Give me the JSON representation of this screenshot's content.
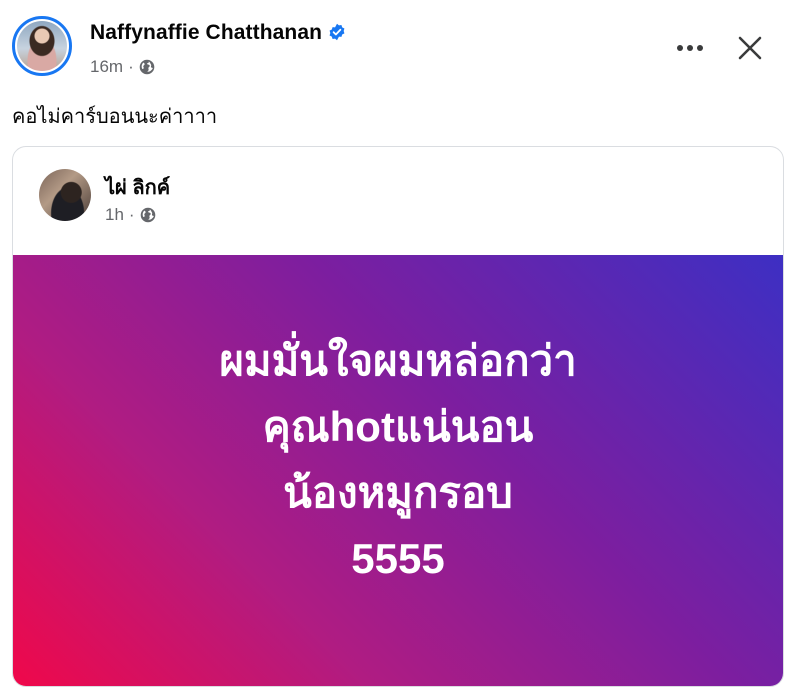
{
  "post": {
    "author": "Naffynaffie Chatthanan",
    "verified": true,
    "time": "16m",
    "separator": "·",
    "caption": "คอไม่คาร์บอนนะค่าาาา",
    "icons": {
      "more": "more-horizontal-icon",
      "close": "close-icon",
      "privacy": "globe-icon",
      "badge": "verified-badge-icon"
    }
  },
  "shared": {
    "author": "ไผ่ ลิกค์",
    "time": "1h",
    "separator": "·",
    "lines": [
      "ผมมั่นใจผมหล่อกว่า",
      "คุณhotแน่นอน",
      "น้องหมูกรอบ",
      "5555"
    ],
    "colors": {
      "gradient_start": "#f0084a",
      "gradient_end": "#3d2fc3"
    }
  },
  "colors": {
    "accent": "#1877f2",
    "secondary_text": "#65676b"
  }
}
